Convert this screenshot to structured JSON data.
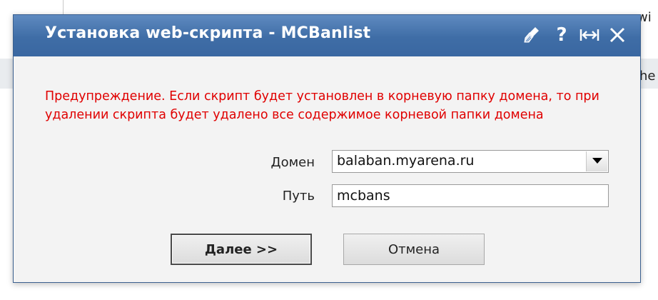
{
  "background": {
    "fragment_top_right": "wi",
    "fragment_mid_right": "he"
  },
  "dialog": {
    "title": "Установка web-скрипта - MCBanlist",
    "titlebar_icons": [
      "broom-icon",
      "help-icon",
      "resize-icon",
      "close-icon"
    ],
    "help_glyph": "?",
    "warning": "Предупреждение. Если скрипт будет установлен в корневую папку домена, то при удалении скрипта будет удалено все содержимое корневой папки домена",
    "domain_label": "Домен",
    "domain_value": "balaban.myarena.ru",
    "path_label": "Путь",
    "path_value": "mcbans",
    "next_button": "Далее >>",
    "cancel_button": "Отмена"
  },
  "colors": {
    "titlebar": "#3f6da6",
    "warning_text": "#e00000",
    "dialog_body": "#f3f3f3"
  }
}
